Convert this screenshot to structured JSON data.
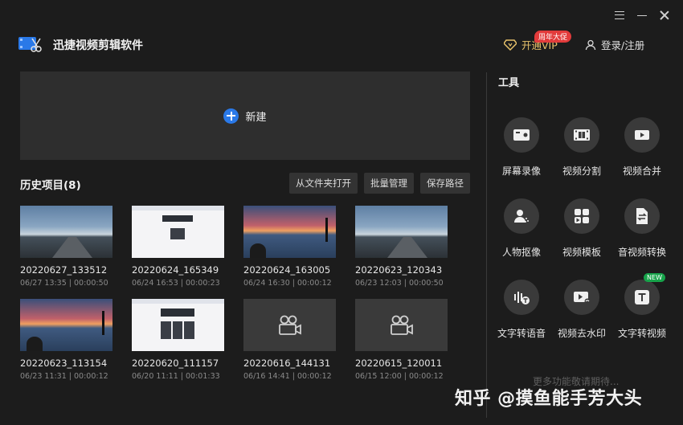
{
  "header": {
    "app_title": "迅捷视频剪辑软件",
    "vip_label": "开通VIP",
    "vip_badge": "周年大促",
    "login_label": "登录/注册"
  },
  "new_project": {
    "label": "新建"
  },
  "history": {
    "title": "历史项目(8)",
    "buttons": [
      "从文件夹打开",
      "批量管理",
      "保存路径"
    ],
    "items": [
      {
        "name": "20220627_133512",
        "meta": "06/27 13:35 | 00:00:50",
        "thumb": "road"
      },
      {
        "name": "20220624_165349",
        "meta": "06/24 16:53 | 00:00:23",
        "thumb": "doc"
      },
      {
        "name": "20220624_163005",
        "meta": "06/24 16:30 | 00:00:12",
        "thumb": "sunset"
      },
      {
        "name": "20220623_120343",
        "meta": "06/23 12:03 | 00:00:50",
        "thumb": "road"
      },
      {
        "name": "20220623_113154",
        "meta": "06/23 11:31 | 00:00:12",
        "thumb": "sunset"
      },
      {
        "name": "20220620_111157",
        "meta": "06/20 11:11 | 00:01:33",
        "thumb": "doc2"
      },
      {
        "name": "20220616_144131",
        "meta": "06/16 14:41 | 00:00:12",
        "thumb": "empty"
      },
      {
        "name": "20220615_120011",
        "meta": "06/15 12:00 | 00:00:12",
        "thumb": "empty"
      }
    ]
  },
  "tools": {
    "title": "工具",
    "items": [
      {
        "label": "屏幕录像",
        "icon": "camera-icon"
      },
      {
        "label": "视频分割",
        "icon": "film-split-icon"
      },
      {
        "label": "视频合并",
        "icon": "video-merge-icon"
      },
      {
        "label": "人物抠像",
        "icon": "person-cutout-icon"
      },
      {
        "label": "视频模板",
        "icon": "template-icon"
      },
      {
        "label": "音视频转换",
        "icon": "convert-icon"
      },
      {
        "label": "文字转语音",
        "icon": "text-to-speech-icon"
      },
      {
        "label": "视频去水印",
        "icon": "remove-watermark-icon"
      },
      {
        "label": "文字转视频",
        "icon": "text-to-video-icon",
        "badge": "NEW"
      }
    ],
    "more_label": "更多功能敬请期待..."
  },
  "watermark": "知乎 @摸鱼能手芳大头",
  "colors": {
    "accent": "#2a79e8",
    "vip_gold": "#e8c26b",
    "badge_red": "#e23b3b",
    "new_green": "#17a34a"
  }
}
